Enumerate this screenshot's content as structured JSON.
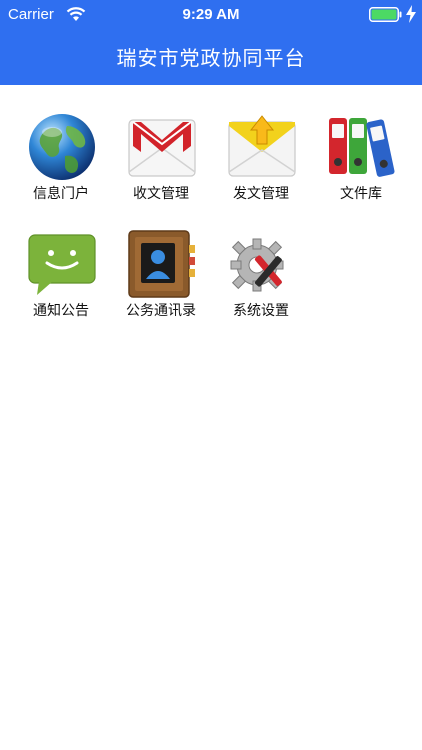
{
  "status": {
    "carrier": "Carrier",
    "time": "9:29 AM"
  },
  "header": {
    "title": "瑞安市党政协同平台"
  },
  "tiles": [
    {
      "label": "信息门户",
      "icon": "globe-icon"
    },
    {
      "label": "收文管理",
      "icon": "mail-icon"
    },
    {
      "label": "发文管理",
      "icon": "send-mail-icon"
    },
    {
      "label": "文件库",
      "icon": "binders-icon"
    },
    {
      "label": "通知公告",
      "icon": "message-icon"
    },
    {
      "label": "公务通讯录",
      "icon": "address-book-icon"
    },
    {
      "label": "系统设置",
      "icon": "settings-gear-icon"
    }
  ],
  "colors": {
    "header": "#2f6ff0",
    "background": "#ffffff"
  }
}
